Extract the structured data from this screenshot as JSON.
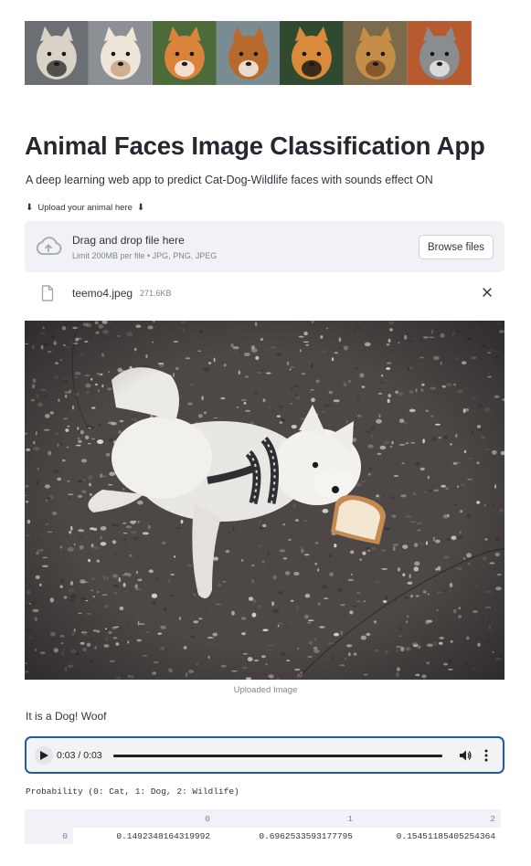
{
  "banner": {
    "animals": [
      {
        "name": "cat-tabby",
        "bg": "#6b6f74",
        "face": "#d9d2c6",
        "accent": "#3a3a38"
      },
      {
        "name": "cat-white",
        "bg": "#8c8f94",
        "face": "#efe6da",
        "accent": "#c9a585"
      },
      {
        "name": "corgi",
        "bg": "#4d6a3a",
        "face": "#d9833b",
        "accent": "#f5efe6"
      },
      {
        "name": "sheltie",
        "bg": "#7a8c93",
        "face": "#b86a2e",
        "accent": "#f3ece4"
      },
      {
        "name": "tiger",
        "bg": "#2f4a2f",
        "face": "#d98a3a",
        "accent": "#1d1b18"
      },
      {
        "name": "lion",
        "bg": "#7c6a4c",
        "face": "#c48e48",
        "accent": "#7a4d24"
      },
      {
        "name": "wolf",
        "bg": "#b85a2f",
        "face": "#8a8d90",
        "accent": "#e6e6e6"
      }
    ]
  },
  "app": {
    "title": "Animal Faces Image Classification App",
    "subtitle": "A deep learning web app to predict Cat-Dog-Wildlife faces with sounds effect ON"
  },
  "uploader": {
    "label_text": "Upload your animal here",
    "arrow_glyph": "⬇",
    "drop_title": "Drag and drop file here",
    "limit_text": "Limit 200MB per file • JPG, PNG, JPEG",
    "browse_label": "Browse files",
    "file_name": "teemo4.jpeg",
    "file_size": "271.6KB"
  },
  "image": {
    "caption": "Uploaded Image"
  },
  "result": {
    "text": "It is a Dog! Woof"
  },
  "audio": {
    "time": "0:03 / 0:03",
    "progress_fraction": 1.0
  },
  "probability": {
    "label": "Probability (0: Cat, 1: Dog, 2: Wildlife)",
    "columns": [
      "0",
      "1",
      "2"
    ],
    "rows": [
      {
        "index": "0",
        "values": [
          "0.1492348164319992",
          "0.6962533593177795",
          "0.15451185405254364"
        ]
      }
    ]
  },
  "colors": {
    "accent_focus": "#1f5aa6",
    "dropzone_bg": "#f0f2f6",
    "muted_text": "#808495"
  }
}
